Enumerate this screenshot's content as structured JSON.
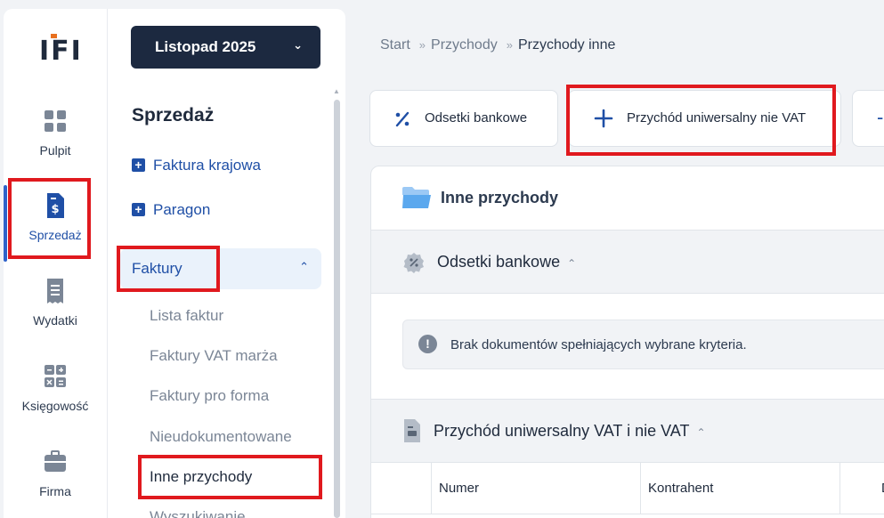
{
  "rail": {
    "logo": "IFI",
    "items": [
      {
        "label": "Pulpit",
        "icon": "grid-icon"
      },
      {
        "label": "Sprzedaż",
        "icon": "invoice-dollar-icon"
      },
      {
        "label": "Wydatki",
        "icon": "receipt-icon"
      },
      {
        "label": "Księgowość",
        "icon": "calculator-icon"
      },
      {
        "label": "Firma",
        "icon": "briefcase-icon"
      }
    ]
  },
  "sidebar": {
    "month": "Listopad 2025",
    "section_title": "Sprzedaż",
    "quick_adds": [
      "Faktura krajowa",
      "Paragon"
    ],
    "group_label": "Faktury",
    "sub_items": [
      "Lista faktur",
      "Faktury VAT marża",
      "Faktury pro forma",
      "Nieudokumentowane",
      "Inne przychody",
      "Wyszukiwanie"
    ]
  },
  "breadcrumb": [
    "Start",
    "Przychody",
    "Przychody inne"
  ],
  "actions": [
    "Odsetki bankowe",
    "Przychód uniwersalny nie VAT"
  ],
  "panel": {
    "title": "Inne przychody",
    "group1": "Odsetki bankowe",
    "empty_message": "Brak dokumentów spełniających wybrane kryteria.",
    "group2": "Przychód uniwersalny VAT i nie VAT",
    "columns": [
      "",
      "Numer",
      "Kontrahent",
      "D"
    ]
  },
  "colors": {
    "accent": "#1f4fa6",
    "dark": "#1c2940",
    "highlight": "#e0191e",
    "logo_orange": "#e8701f"
  }
}
